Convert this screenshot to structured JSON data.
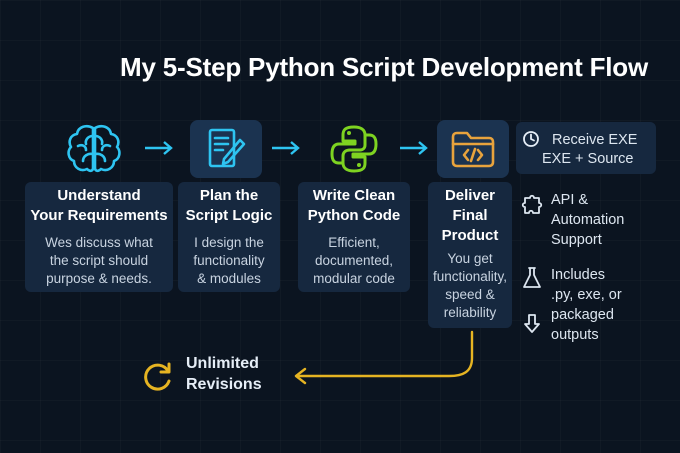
{
  "title": "My 5-Step Python Script Development Flow",
  "steps": [
    {
      "title_lines": [
        "Understand",
        "Your Requirements"
      ],
      "desc_lines": [
        "Wes discuss what",
        "the script should",
        "purpose & needs."
      ]
    },
    {
      "title_lines": [
        "Plan the",
        "Script Logic"
      ],
      "desc_lines": [
        "I design the",
        "functionality",
        "& modules"
      ]
    },
    {
      "title_lines": [
        "Write Clean",
        "Python Code"
      ],
      "desc_lines": [
        "Efficient,",
        "documented,",
        "modular code"
      ]
    },
    {
      "title_lines": [
        "Deliver",
        "Final",
        "Product"
      ],
      "desc_lines": [
        "You get",
        "functionality,",
        "speed &",
        "reliability"
      ]
    }
  ],
  "receive": {
    "line1": "Receive EXE",
    "line2": "EXE + Source"
  },
  "features": [
    {
      "icon": "puzzle-icon",
      "lines": [
        "API &",
        "Automation",
        "Support"
      ]
    },
    {
      "icon": "flask-icon",
      "lines": [
        "Includes",
        ".py, exe, or",
        "packaged",
        "outputs"
      ]
    }
  ],
  "revisions": {
    "lines": [
      "Unlimited",
      "Revisions"
    ]
  },
  "colors": {
    "background": "#0b1420",
    "card": "#16283f",
    "cyan": "#2ec4f1",
    "python_green": "#7ed321",
    "folder_orange": "#e8a33d",
    "gold": "#e6b422"
  }
}
